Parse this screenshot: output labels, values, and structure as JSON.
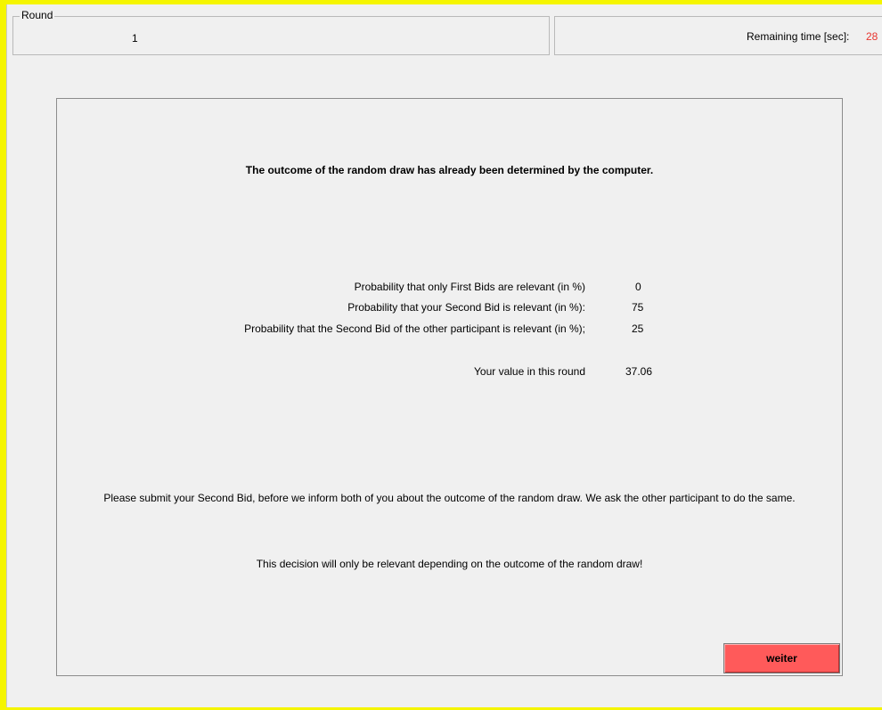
{
  "header": {
    "round_legend": "Round",
    "round_value": "1",
    "time_label": "Remaining time [sec]:",
    "time_value": "28"
  },
  "main": {
    "headline": "The outcome of the random draw has already been determined by the computer.",
    "probabilities": [
      {
        "label": "Probability that only First Bids are relevant (in %)",
        "value": "0"
      },
      {
        "label": "Probability that your Second Bid is relevant  (in %):",
        "value": "75"
      },
      {
        "label": "Probability that the Second Bid of the other participant is relevant (in %);",
        "value": "25"
      }
    ],
    "value_label": "Your value in this round",
    "value": "37.06",
    "instruction": "Please submit your Second Bid, before we inform both of you about the outcome of the random draw. We ask the other participant to do the same.",
    "note": "This decision will only be relevant depending on the outcome of the random draw!",
    "button_label": "weiter"
  },
  "colors": {
    "frame": "#f5f500",
    "time_value": "#e8352f",
    "button": "#ff5a5a"
  }
}
